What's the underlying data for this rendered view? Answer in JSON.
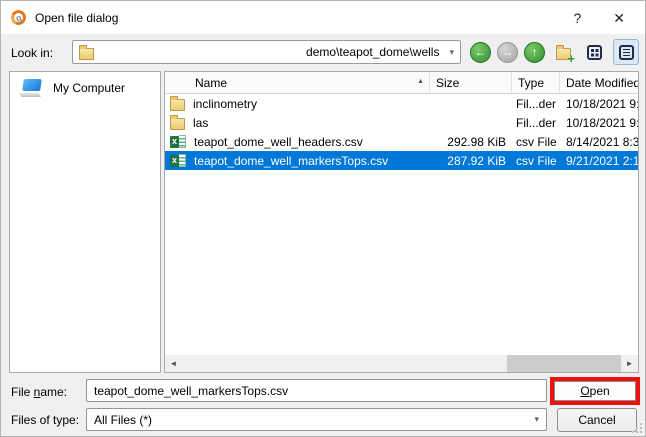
{
  "window": {
    "title": "Open file dialog"
  },
  "icons": {
    "app_logo": "g",
    "help": "?",
    "close": "✕",
    "back": "←",
    "forward": "→",
    "up": "↑",
    "new_folder_plus": "+",
    "dropdown": "▾",
    "sort_ascending": "▲",
    "scroll_left": "◄",
    "scroll_right": "►",
    "csv_letter": "x"
  },
  "toolbar": {
    "look_in_label": "Look in:",
    "path": "demo\\teapot_dome\\wells"
  },
  "sidebar": {
    "items": [
      {
        "label": "My Computer"
      }
    ]
  },
  "file_list": {
    "columns": [
      "Name",
      "Size",
      "Type",
      "Date Modified"
    ],
    "rows": [
      {
        "name": "inclinometry",
        "size": "",
        "type": "Fil...der",
        "date": "10/18/2021 9:",
        "icon": "folder",
        "selected": false
      },
      {
        "name": "las",
        "size": "",
        "type": "Fil...der",
        "date": "10/18/2021 9:",
        "icon": "folder",
        "selected": false
      },
      {
        "name": "teapot_dome_well_headers.csv",
        "size": "292.98 KiB",
        "type": "csv File",
        "date": "8/14/2021 8:3",
        "icon": "csv",
        "selected": false
      },
      {
        "name": "teapot_dome_well_markersTops.csv",
        "size": "287.92 KiB",
        "type": "csv File",
        "date": "9/21/2021 2:1",
        "icon": "csv",
        "selected": true
      }
    ]
  },
  "footer": {
    "file_name_label": {
      "pre": "File ",
      "mnemonic": "n",
      "post": "ame:"
    },
    "file_name_value": "teapot_dome_well_markersTops.csv",
    "open_label": {
      "mnemonic": "O",
      "post": "pen"
    },
    "files_of_type_label": "Files of type:",
    "files_of_type_value": "All Files (*)",
    "cancel_label": "Cancel"
  },
  "colors": {
    "selection": "#0078d7",
    "annotation_red": "#e8120f",
    "folder_yellow": "#eccb67",
    "csv_green": "#217346",
    "nav_green": "#2f8f2f"
  }
}
